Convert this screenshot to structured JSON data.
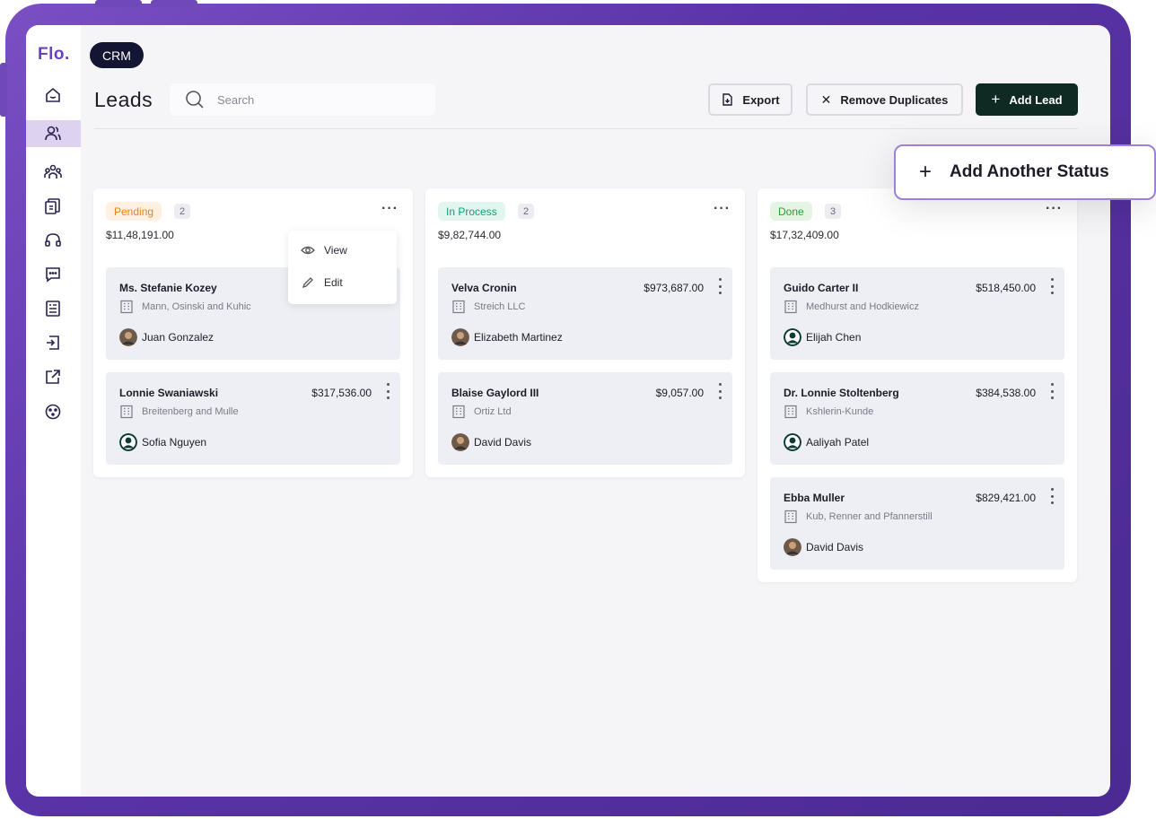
{
  "app": {
    "logo": "Flo.",
    "module": "CRM"
  },
  "page": {
    "title": "Leads"
  },
  "search": {
    "placeholder": "Search"
  },
  "toolbar": {
    "export_label": "Export",
    "remove_duplicates_label": "Remove Duplicates",
    "add_lead_label": "Add Lead"
  },
  "sidebar": {
    "items": [
      "home-icon",
      "users-icon",
      "team-icon",
      "documents-icon",
      "headset-icon",
      "chat-icon",
      "notes-icon",
      "login-icon",
      "external-link-icon",
      "palette-icon"
    ],
    "active": "users-icon"
  },
  "add_status": {
    "label": "Add Another Status"
  },
  "context_menu": {
    "items": [
      {
        "label": "View",
        "icon": "eye-icon"
      },
      {
        "label": "Edit",
        "icon": "pencil-icon"
      }
    ]
  },
  "columns": [
    {
      "status": "Pending",
      "count": "2",
      "total": "$11,48,191.00",
      "pill_bg": "#fff0e2",
      "pill_color": "#e7841c",
      "cards": [
        {
          "name": "Ms. Stefanie Kozey",
          "amount": "",
          "company": "Mann, Osinski and Kuhic",
          "owner": "Juan Gonzalez",
          "avatar": "photo"
        },
        {
          "name": "Lonnie Swaniawski",
          "amount": "$317,536.00",
          "company": "Breitenberg and Mulle",
          "owner": "Sofia Nguyen",
          "avatar": "default"
        }
      ]
    },
    {
      "status": "In Process",
      "count": "2",
      "total": "$9,82,744.00",
      "pill_bg": "#e2f6f0",
      "pill_color": "#1a9a76",
      "cards": [
        {
          "name": "Velva Cronin",
          "amount": "$973,687.00",
          "company": "Streich LLC",
          "owner": "Elizabeth Martinez",
          "avatar": "photo"
        },
        {
          "name": "Blaise Gaylord III",
          "amount": "$9,057.00",
          "company": "Ortiz Ltd",
          "owner": "David Davis",
          "avatar": "photo"
        }
      ]
    },
    {
      "status": "Done",
      "count": "3",
      "total": "$17,32,409.00",
      "pill_bg": "#e4f5e4",
      "pill_color": "#2e9a37",
      "cards": [
        {
          "name": "Guido Carter II",
          "amount": "$518,450.00",
          "company": "Medhurst and Hodkiewicz",
          "owner": "Elijah Chen",
          "avatar": "default"
        },
        {
          "name": "Dr. Lonnie Stoltenberg",
          "amount": "$384,538.00",
          "company": "Kshlerin-Kunde",
          "owner": "Aaliyah Patel",
          "avatar": "default"
        },
        {
          "name": "Ebba Muller",
          "amount": "$829,421.00",
          "company": "Kub, Renner and Pfannerstill",
          "owner": "David Davis",
          "avatar": "photo"
        }
      ]
    }
  ]
}
